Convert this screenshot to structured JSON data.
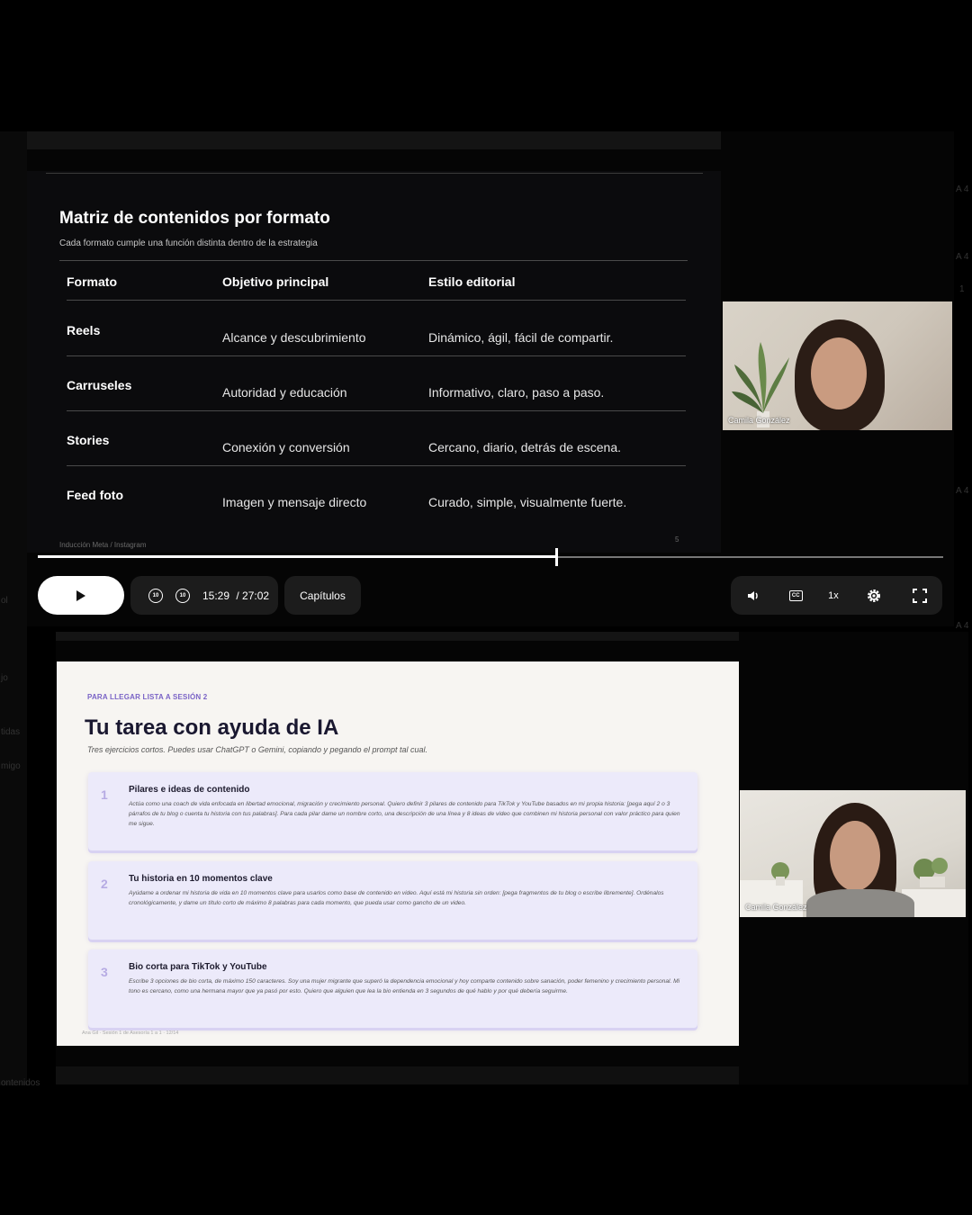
{
  "background_fragments": [
    "A 4",
    "A 4",
    "1",
    "A 4",
    "A 4",
    "ol",
    "jo",
    "tidas",
    "migo",
    "ontenidos"
  ],
  "player1": {
    "slide": {
      "title": "Matriz de contenidos por formato",
      "subtitle": "Cada formato cumple una función distinta dentro de la estrategia",
      "headers": [
        "Formato",
        "Objetivo principal",
        "Estilo editorial"
      ],
      "rows": [
        {
          "formato": "Reels",
          "objetivo": "Alcance y descubrimiento",
          "estilo": "Dinámico, ágil, fácil de compartir."
        },
        {
          "formato": "Carruseles",
          "objetivo": "Autoridad y educación",
          "estilo": "Informativo, claro, paso a paso."
        },
        {
          "formato": "Stories",
          "objetivo": "Conexión y conversión",
          "estilo": "Cercano, diario, detrás de escena."
        },
        {
          "formato": "Feed foto",
          "objetivo": "Imagen y mensaje directo",
          "estilo": "Curado, simple, visualmente fuerte."
        }
      ],
      "footer_left": "Inducción Meta / Instagram",
      "page_number": "5"
    },
    "camera": {
      "name": "Camila González"
    },
    "progress_fraction": 0.573,
    "controls": {
      "current_time": "15:29",
      "duration": "/ 27:02",
      "skip_back_label": "10",
      "skip_forward_label": "10",
      "chapters_label": "Capítulos",
      "speed_label": "1x",
      "cc_label": "CC"
    }
  },
  "player2": {
    "slide": {
      "kicker": "PARA LLEGAR LISTA A SESIÓN 2",
      "title": "Tu tarea con ayuda de IA",
      "subtitle": "Tres ejercicios cortos. Puedes usar ChatGPT o Gemini, copiando y pegando el prompt tal cual.",
      "cards": [
        {
          "num": "1",
          "title": "Pilares e ideas de contenido",
          "body": "Actúa como una coach de vida enfocada en libertad emocional, migración y crecimiento personal. Quiero definir 3 pilares de contenido para TikTok y YouTube basados en mi propia historia: [pega aquí 2 o 3 párrafos de tu blog o cuenta tu historia con tus palabras]. Para cada pilar dame un nombre corto, una descripción de una línea y 8 ideas de video que combinen mi historia personal con valor práctico para quien me sigue."
        },
        {
          "num": "2",
          "title": "Tu historia en 10 momentos clave",
          "body": "Ayúdame a ordenar mi historia de vida en 10 momentos clave para usarlos como base de contenido en video. Aquí está mi historia sin orden: [pega fragmentos de tu blog o escribe libremente]. Ordénalos cronológicamente, y dame un título corto de máximo 8 palabras para cada momento, que pueda usar como gancho de un video."
        },
        {
          "num": "3",
          "title": "Bio corta para TikTok y YouTube",
          "body": "Escribe 3 opciones de bio corta, de máximo 150 caracteres. Soy una mujer migrante que superó la dependencia emocional y hoy comparte contenido sobre sanación, poder femenino y crecimiento personal. Mi tono es cercano, como una hermana mayor que ya pasó por esto. Quiero que alguien que lea la bio entienda en 3 segundos de qué hablo y por qué debería seguirme."
        }
      ],
      "footer": "Ana Gil · Sesión 1 de Asesoría 1 a 1 · 12/14"
    },
    "camera": {
      "name": "Camila González"
    }
  }
}
